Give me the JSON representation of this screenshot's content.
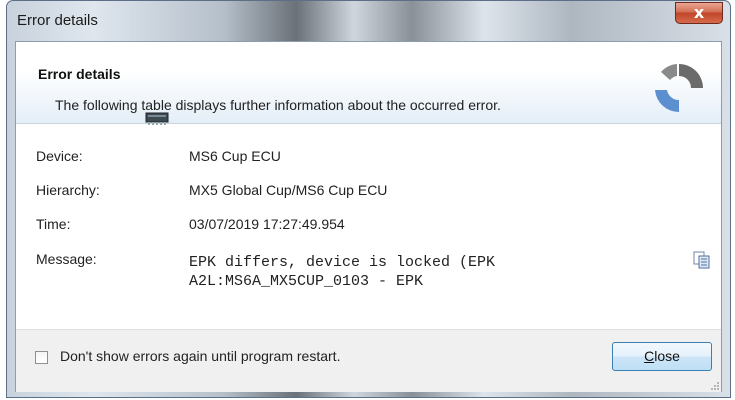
{
  "window": {
    "title": "Error details",
    "close_glyph": "x"
  },
  "header": {
    "title": "Error details",
    "description": "The following table displays further information about the occurred error."
  },
  "details": {
    "device_label": "Device:",
    "device_value": "MS6 Cup ECU",
    "hierarchy_label": "Hierarchy:",
    "hierarchy_value": "MX5 Global Cup/MS6 Cup ECU",
    "time_label": "Time:",
    "time_value": "03/07/2019 17:27:49.954",
    "message_label": "Message:",
    "message_value": "EPK differs, device is locked (EPK\nA2L:MS6A_MX5CUP_0103 - EPK"
  },
  "footer": {
    "checkbox_label": "Don't show errors again until program restart.",
    "checkbox_checked": false,
    "close_button_underlined": "C",
    "close_button_rest": "lose"
  },
  "icons": {
    "device": "ecu-device-icon",
    "copy": "copy-icon",
    "spinner": "activity-spinner-icon"
  },
  "colors": {
    "close_x": "#c2452a",
    "button_border": "#3c7fb1",
    "spinner_gray": "#6b6b6b",
    "spinner_blue": "#5b8fcf"
  }
}
